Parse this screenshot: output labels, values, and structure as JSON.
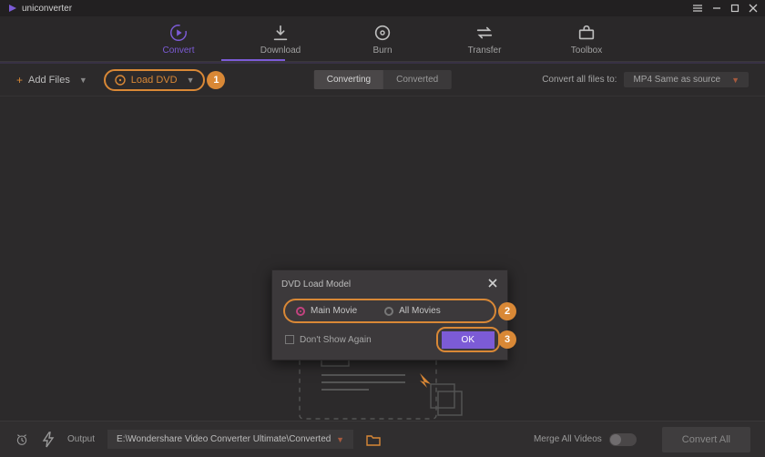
{
  "app": {
    "title": "uniconverter"
  },
  "window_controls": {
    "menu": "≡",
    "min": "—",
    "max": "□",
    "close": "✕"
  },
  "tabs": [
    {
      "id": "convert",
      "label": "Convert",
      "active": true
    },
    {
      "id": "download",
      "label": "Download",
      "active": false
    },
    {
      "id": "burn",
      "label": "Burn",
      "active": false
    },
    {
      "id": "transfer",
      "label": "Transfer",
      "active": false
    },
    {
      "id": "toolbox",
      "label": "Toolbox",
      "active": false
    }
  ],
  "actionbar": {
    "add_files": "Add Files",
    "load_dvd": "Load DVD",
    "seg_converting": "Converting",
    "seg_converted": "Converted",
    "convert_all_label": "Convert all files to:",
    "format_preset": "MP4 Same as source"
  },
  "modal": {
    "title": "DVD Load Model",
    "option_main": "Main Movie",
    "option_all": "All Movies",
    "dont_show": "Don't Show Again",
    "ok": "OK"
  },
  "footer": {
    "output_label": "Output",
    "output_path": "E:\\Wondershare Video Converter Ultimate\\Converted",
    "merge_label": "Merge All Videos",
    "convert_all": "Convert All"
  },
  "step_badges": {
    "one": "1",
    "two": "2",
    "three": "3"
  },
  "colors": {
    "accent": "#7c5bd6",
    "highlight": "#d98836"
  }
}
